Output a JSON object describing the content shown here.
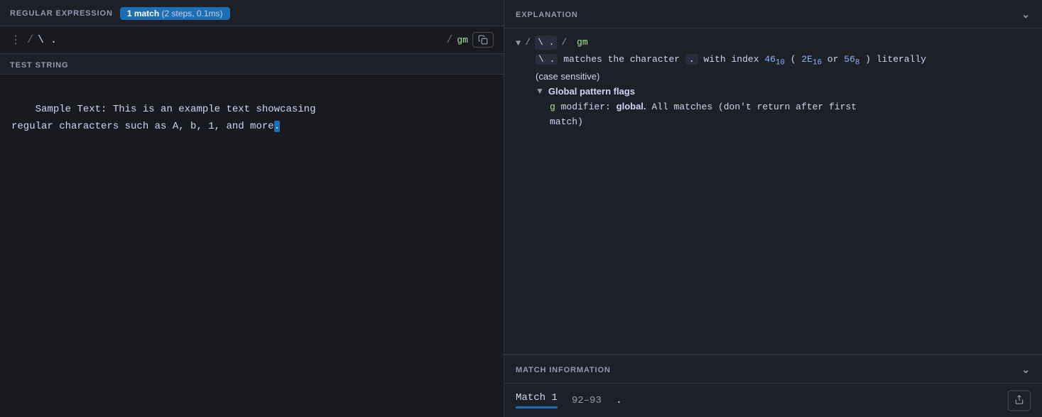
{
  "left": {
    "regex_section_label": "REGULAR EXPRESSION",
    "match_badge": "1 match",
    "match_steps": "(2 steps, 0.1ms)",
    "regex_dots": "⋮",
    "regex_slash_open": "/",
    "regex_pattern": "\\ .",
    "regex_slash_close": "/",
    "regex_flags": "gm",
    "test_string_label": "TEST STRING",
    "test_string_line1": "Sample Text: This is an example text showcasing",
    "test_string_line2": "regular characters such as A, b, 1, and more.",
    "highlighted_char": "."
  },
  "right": {
    "explanation_label": "EXPLANATION",
    "tree_root": "▼",
    "tree_slash1": "/",
    "tree_pattern": "\\ .",
    "tree_slash2": "/",
    "tree_flags": "gm",
    "desc_pattern": "\\ .",
    "desc_text1": "matches the character",
    "desc_dot": ".",
    "desc_text2": "with index",
    "index_46": "46",
    "index_46_sub": "10",
    "desc_paren_open": "(",
    "index_2E": "2E",
    "index_2E_sub": "16",
    "desc_or": "or",
    "index_56": "56",
    "index_56_sub": "8",
    "desc_paren_close": ") literally",
    "case_text": "(case sensitive)",
    "global_arrow": "▼",
    "global_label": "Global pattern flags",
    "modifier_g": "g",
    "modifier_text": "modifier:",
    "modifier_bold": "global.",
    "modifier_desc": "All matches (don't return after first",
    "modifier_desc2": "match)",
    "match_info_label": "MATCH INFORMATION",
    "match_tab_label": "Match 1",
    "match_range": "92–93",
    "match_value": "."
  }
}
